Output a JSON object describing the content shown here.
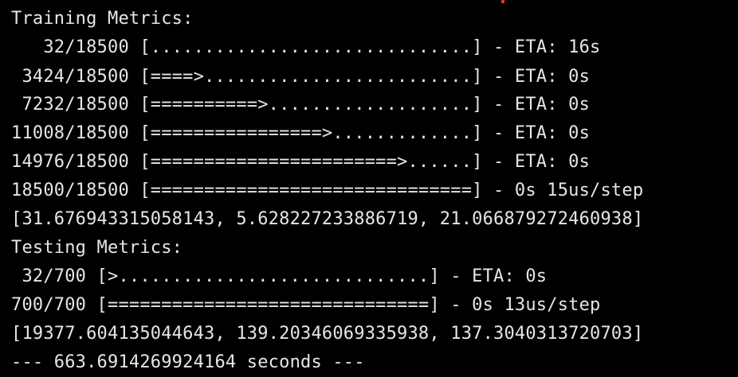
{
  "terminal": {
    "lines": [
      "Training Metrics:",
      "   32/18500 [..............................] - ETA: 16s",
      " 3424/18500 [====>.........................] - ETA: 0s",
      " 7232/18500 [==========>...................] - ETA: 0s",
      "11008/18500 [================>.............] - ETA: 0s",
      "14976/18500 [=======================>......] - ETA: 0s",
      "18500/18500 [==============================] - 0s 15us/step",
      "[31.676943315058143, 5.628227233886719, 21.066879272460938]",
      "Testing Metrics:",
      " 32/700 [>.............................] - ETA: 0s",
      "700/700 [==============================] - 0s 13us/step",
      "[19377.604135044643, 139.20346069335938, 137.3040313720703]",
      "--- 663.6914269924164 seconds ---"
    ],
    "colors": {
      "background": "#000000",
      "text": "#e6e6e6",
      "cursor_marker": "#d23a2f"
    }
  }
}
